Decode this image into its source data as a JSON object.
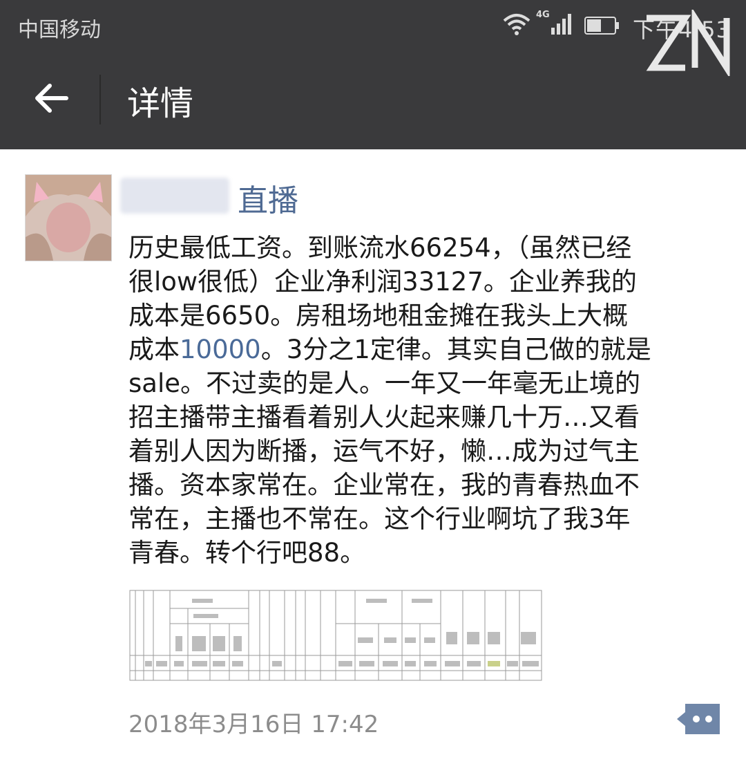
{
  "status_bar": {
    "carrier": "中国移动",
    "network": "4G",
    "time": "下午4:53"
  },
  "watermark": {
    "text": "ZN"
  },
  "header": {
    "title": "详情"
  },
  "post": {
    "author_tag": "直播",
    "lines": [
      "历史最低工资。到账流水66254，（虽然已经",
      "很low很低）企业净利润33127。企业养我的",
      "成本是6650。房租场地租金摊在我头上大概",
      "成本",
      "sale。不过卖的是人。一年又一年毫无止境的",
      "招主播带主播看着别人火起来赚几十万…又看",
      "着别人因为断播，运气不好，懒…成为过气主",
      "播。资本家常在。企业常在，我的青春热血不",
      "常在，主播也不常在。这个行业啊坑了我3年",
      "青春。转个行吧88。"
    ],
    "line4_link": "10000",
    "line4_rest": "。3分之1定律。其实自己做的就是",
    "timestamp": "2018年3月16日 17:42"
  },
  "colors": {
    "topbar": "#3a3a3c",
    "link": "#4a6a98",
    "timestamp": "#8c8c8c"
  }
}
